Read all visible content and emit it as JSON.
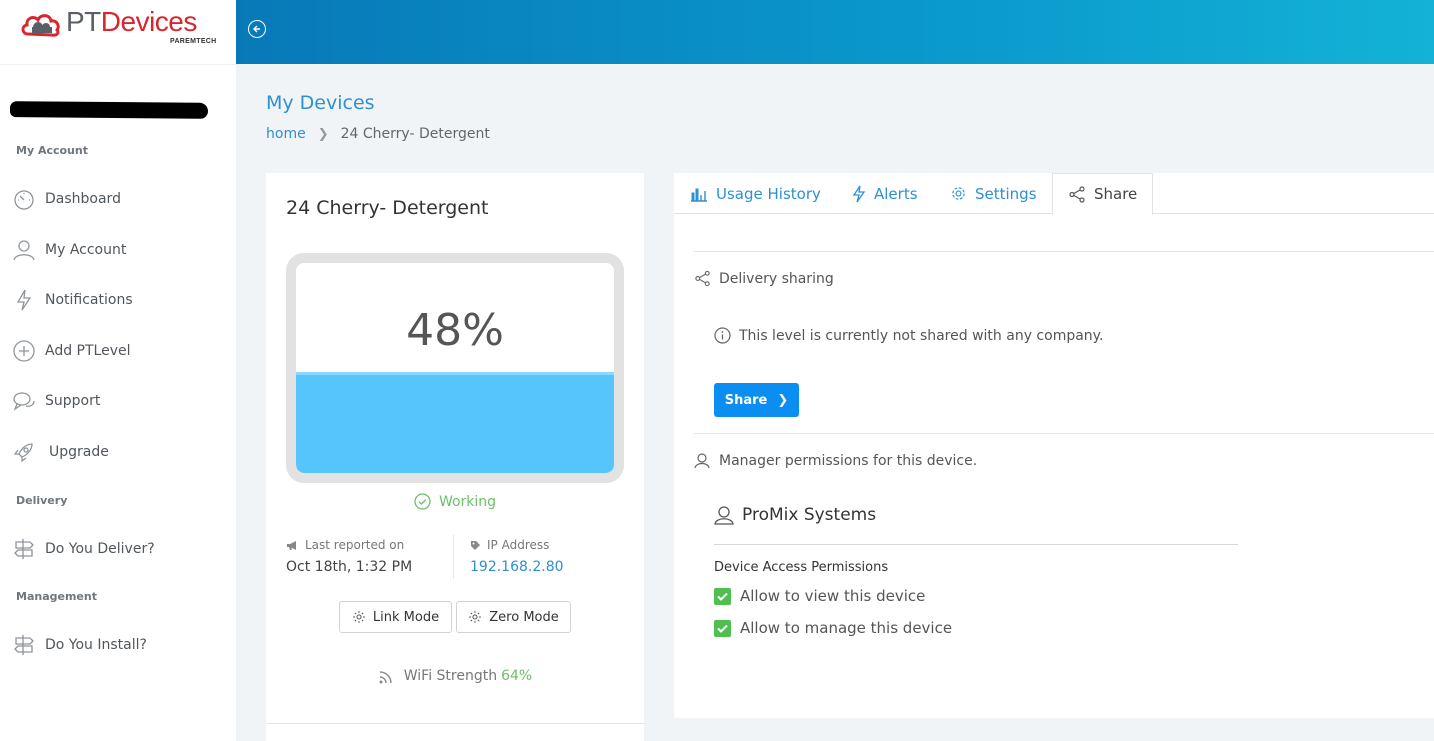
{
  "logo": {
    "pt": "PT",
    "devices": "Devices",
    "sub": "PAREMTECH"
  },
  "sidebar": {
    "sections": {
      "account": "My Account",
      "delivery": "Delivery",
      "management": "Management"
    },
    "items": [
      {
        "label": "Dashboard",
        "icon": "gauge-icon"
      },
      {
        "label": "My Account",
        "icon": "user-icon"
      },
      {
        "label": "Notifications",
        "icon": "bolt-icon"
      },
      {
        "label": "Add PTLevel",
        "icon": "plus-circle-icon"
      },
      {
        "label": "Support",
        "icon": "chat-icon"
      },
      {
        "label": "Upgrade",
        "icon": "rocket-icon"
      },
      {
        "label": "Do You Deliver?",
        "icon": "signpost-icon"
      },
      {
        "label": "Do You Install?",
        "icon": "signpost-icon"
      }
    ]
  },
  "header": {
    "title": "My Devices"
  },
  "breadcrumb": {
    "home": "home",
    "current": "24 Cherry- Detergent"
  },
  "device": {
    "name": "24 Cherry- Detergent",
    "level_percent_text": "48%",
    "level": 0.48,
    "status": "Working",
    "last_reported_label": "Last reported on",
    "last_reported_value": "Oct 18th, 1:32 PM",
    "ip_label": "IP Address",
    "ip_value": "192.168.2.80",
    "link_mode": "Link Mode",
    "zero_mode": "Zero Mode",
    "wifi_label": "WiFi Strength",
    "wifi_value": "64%"
  },
  "tabs": [
    {
      "label": "Usage History",
      "icon": "bar-chart-icon"
    },
    {
      "label": "Alerts",
      "icon": "bolt-icon"
    },
    {
      "label": "Settings",
      "icon": "gear-icon"
    },
    {
      "label": "Share",
      "icon": "share-icon",
      "active": true
    }
  ],
  "share_panel": {
    "delivery_heading": "Delivery sharing",
    "info": "This level is currently not shared with any company.",
    "share_button": "Share",
    "manager_heading": "Manager permissions for this device.",
    "company": "ProMix Systems",
    "permissions_title": "Device Access Permissions",
    "permissions": [
      {
        "label": "Allow to view this device",
        "checked": true
      },
      {
        "label": "Allow to manage this device",
        "checked": true
      }
    ]
  },
  "colors": {
    "accent": "#2f8fd0",
    "fill": "#55c5fc",
    "ok": "#6dbf68",
    "button": "#0b8ef2"
  }
}
